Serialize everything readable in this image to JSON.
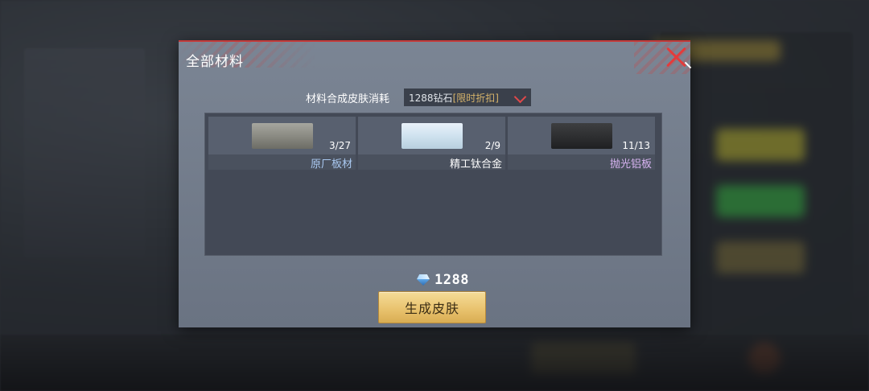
{
  "dialog": {
    "title": "全部材料",
    "cost_label": "材料合成皮肤消耗",
    "cost_value": "1288钻石",
    "cost_tag": "[限时折扣]",
    "materials": [
      {
        "name": "原厂板材",
        "quantity": "3/27",
        "icon": "gray-plate",
        "name_color": "#a9c8f0"
      },
      {
        "name": "精工钛合金",
        "quantity": "2/9",
        "icon": "white-plate",
        "name_color": "#ffffff"
      },
      {
        "name": "抛光铝板",
        "quantity": "11/13",
        "icon": "black-plate",
        "name_color": "#d8b4f2"
      }
    ],
    "balance": "1288",
    "generate_label": "生成皮肤"
  },
  "colors": {
    "accent_red": "#e43b3b",
    "button_gold": "#e9c36f",
    "discount_tag": "#d6b36a"
  }
}
